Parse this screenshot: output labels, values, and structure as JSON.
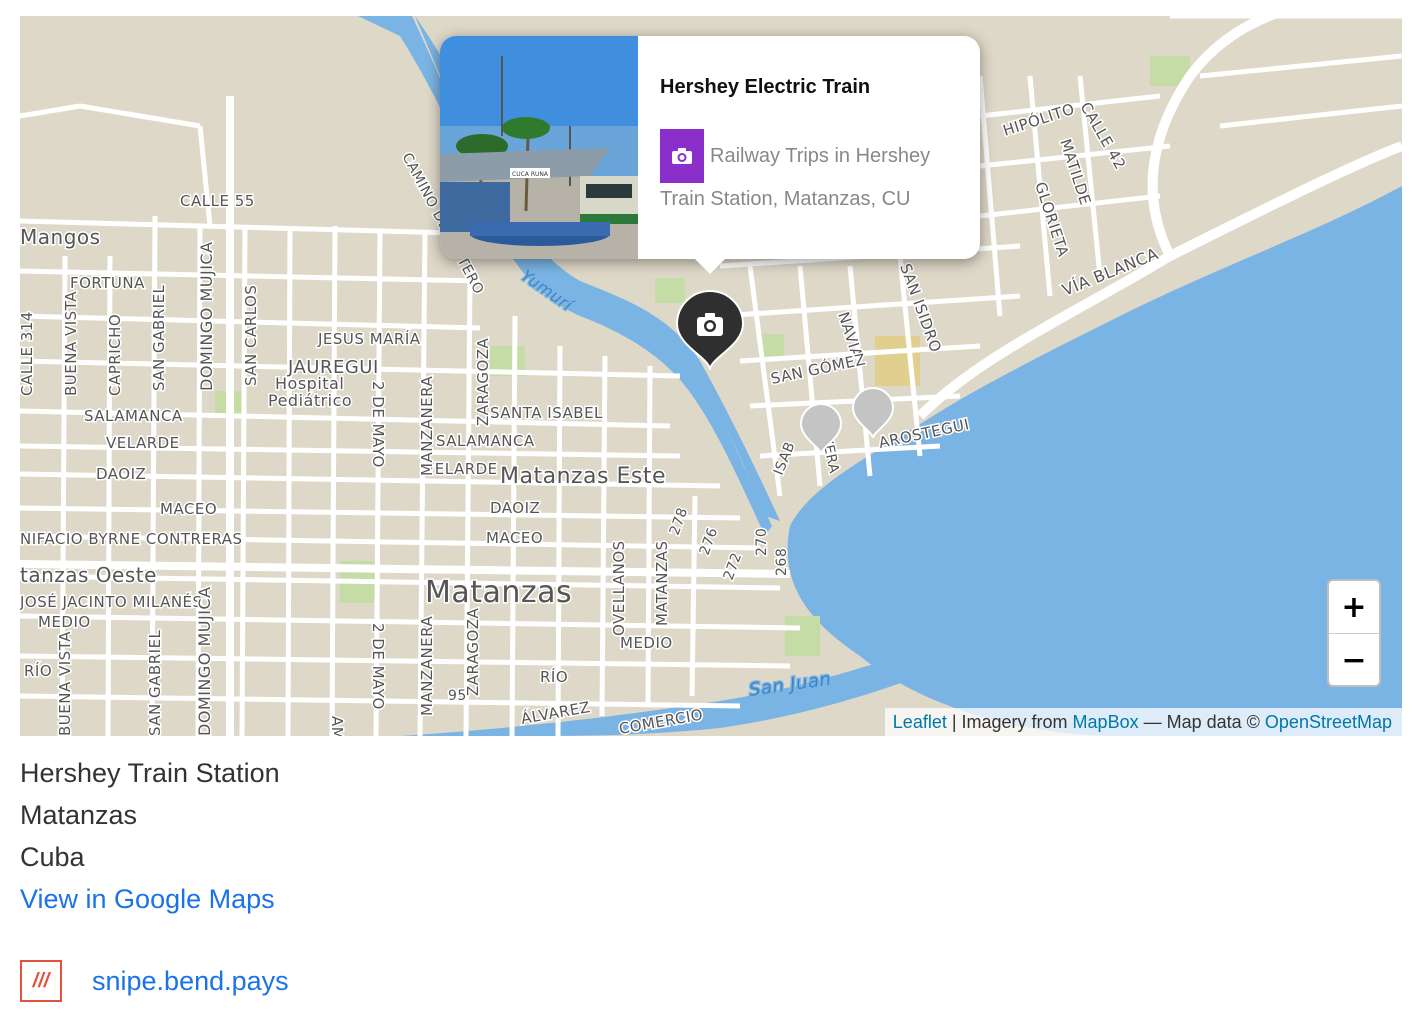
{
  "map": {
    "street_labels": [
      "CALLE 55",
      "FORTUNA",
      "Mangos",
      "JESUS MARÍA",
      "JAUREGUI",
      "Hospital",
      "Pediátrico",
      "SANTA ISABEL",
      "SALAMANCA",
      "VELARDE",
      "DAOIZ",
      "MACEO",
      "NIFACIO BYRNE CONTRERAS",
      "tanzas Oeste",
      "JOSÉ JACINTO MILANÉS",
      "MEDIO",
      "RÍO",
      "ÁLVAREZ",
      "COMERCIO",
      "Matanzas",
      "Matanzas Este",
      "Yumurí",
      "San Juan",
      "VÍA BLANCA",
      "SAN ISIDRO",
      "NAVIA",
      "SAN GÓMEZ",
      "AROSTEGUI",
      "HIPÓLITO",
      "CALLE 42",
      "GLORIETA",
      "MATILDE",
      "2 DE MAYO",
      "MANZANERA",
      "ZARAGOZA",
      "DOMINGO MUJICA",
      "SAN CARLOS",
      "SAN GABRIEL",
      "CAPRICHO",
      "BUENA VISTA",
      "CALLE 314",
      "OVELLANOS",
      "MATANZAS",
      "AMÉRICA",
      "278",
      "276",
      "272",
      "270",
      "268",
      "95",
      "CAMINO DEL ESTERO",
      "VERA",
      "ISAB"
    ],
    "colors": {
      "land": "#ded8c8",
      "water": "#7ab4e4",
      "park": "#c6dca6",
      "road": "#ffffff",
      "marker_active": "#2f2f2f",
      "marker_inactive": "#c4c4c4",
      "category_purple": "#8a2fc9",
      "link": "#1a73e8"
    }
  },
  "popup": {
    "title": "Hershey Electric Train",
    "category_icon": "camera-icon",
    "category": "Railway Trips in Hershey",
    "address": "Train Station, Matanzas, CU",
    "photo_sign": "CUCA RUNA"
  },
  "zoom": {
    "in": "+",
    "out": "−"
  },
  "attribution": {
    "leaflet": "Leaflet",
    "sep1": " | Imagery from ",
    "mapbox": "MapBox",
    "sep2": " — Map data © ",
    "osm": "OpenStreetMap"
  },
  "address": {
    "line1": "Hershey Train Station",
    "line2": "Matanzas",
    "line3": "Cuba",
    "link": "View in Google Maps"
  },
  "what3words": {
    "logo": "///",
    "words": "snipe.bend.pays"
  }
}
